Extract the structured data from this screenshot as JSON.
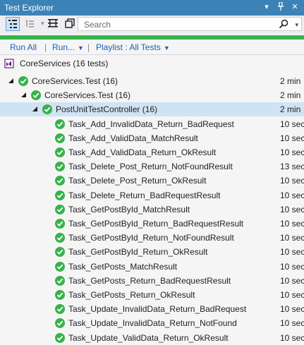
{
  "window": {
    "title": "Test Explorer"
  },
  "search": {
    "placeholder": "Search"
  },
  "commands": {
    "run_all": "Run All",
    "run": "Run...",
    "playlist": "Playlist : All Tests"
  },
  "summary": "CoreServices (16 tests)",
  "colors": {
    "pass": "#36b34a",
    "accent": "#3b82b6",
    "link": "#1a5fb4"
  },
  "tree": [
    {
      "label": "CoreServices.Test (16)",
      "duration": "2 min",
      "level": 0
    },
    {
      "label": "CoreServices.Test (16)",
      "duration": "2 min",
      "level": 1
    },
    {
      "label": "PostUnitTestController (16)",
      "duration": "2 min",
      "level": 2,
      "selected": true
    }
  ],
  "tests": [
    {
      "name": "Task_Add_InvalidData_Return_BadRequest",
      "duration": "10 sec"
    },
    {
      "name": "Task_Add_ValidData_MatchResult",
      "duration": "10 sec"
    },
    {
      "name": "Task_Add_ValidData_Return_OkResult",
      "duration": "10 sec"
    },
    {
      "name": "Task_Delete_Post_Return_NotFoundResult",
      "duration": "13 sec"
    },
    {
      "name": "Task_Delete_Post_Return_OkResult",
      "duration": "10 sec"
    },
    {
      "name": "Task_Delete_Return_BadRequestResult",
      "duration": "10 sec"
    },
    {
      "name": "Task_GetPostById_MatchResult",
      "duration": "10 sec"
    },
    {
      "name": "Task_GetPostById_Return_BadRequestResult",
      "duration": "10 sec"
    },
    {
      "name": "Task_GetPostById_Return_NotFoundResult",
      "duration": "10 sec"
    },
    {
      "name": "Task_GetPostById_Return_OkResult",
      "duration": "10 sec"
    },
    {
      "name": "Task_GetPosts_MatchResult",
      "duration": "10 sec"
    },
    {
      "name": "Task_GetPosts_Return_BadRequestResult",
      "duration": "10 sec"
    },
    {
      "name": "Task_GetPosts_Return_OkResult",
      "duration": "10 sec"
    },
    {
      "name": "Task_Update_InvalidData_Return_BadRequest",
      "duration": "10 sec"
    },
    {
      "name": "Task_Update_InvalidData_Return_NotFound",
      "duration": "10 sec"
    },
    {
      "name": "Task_Update_ValidData_Return_OkResult",
      "duration": "10 sec"
    }
  ]
}
